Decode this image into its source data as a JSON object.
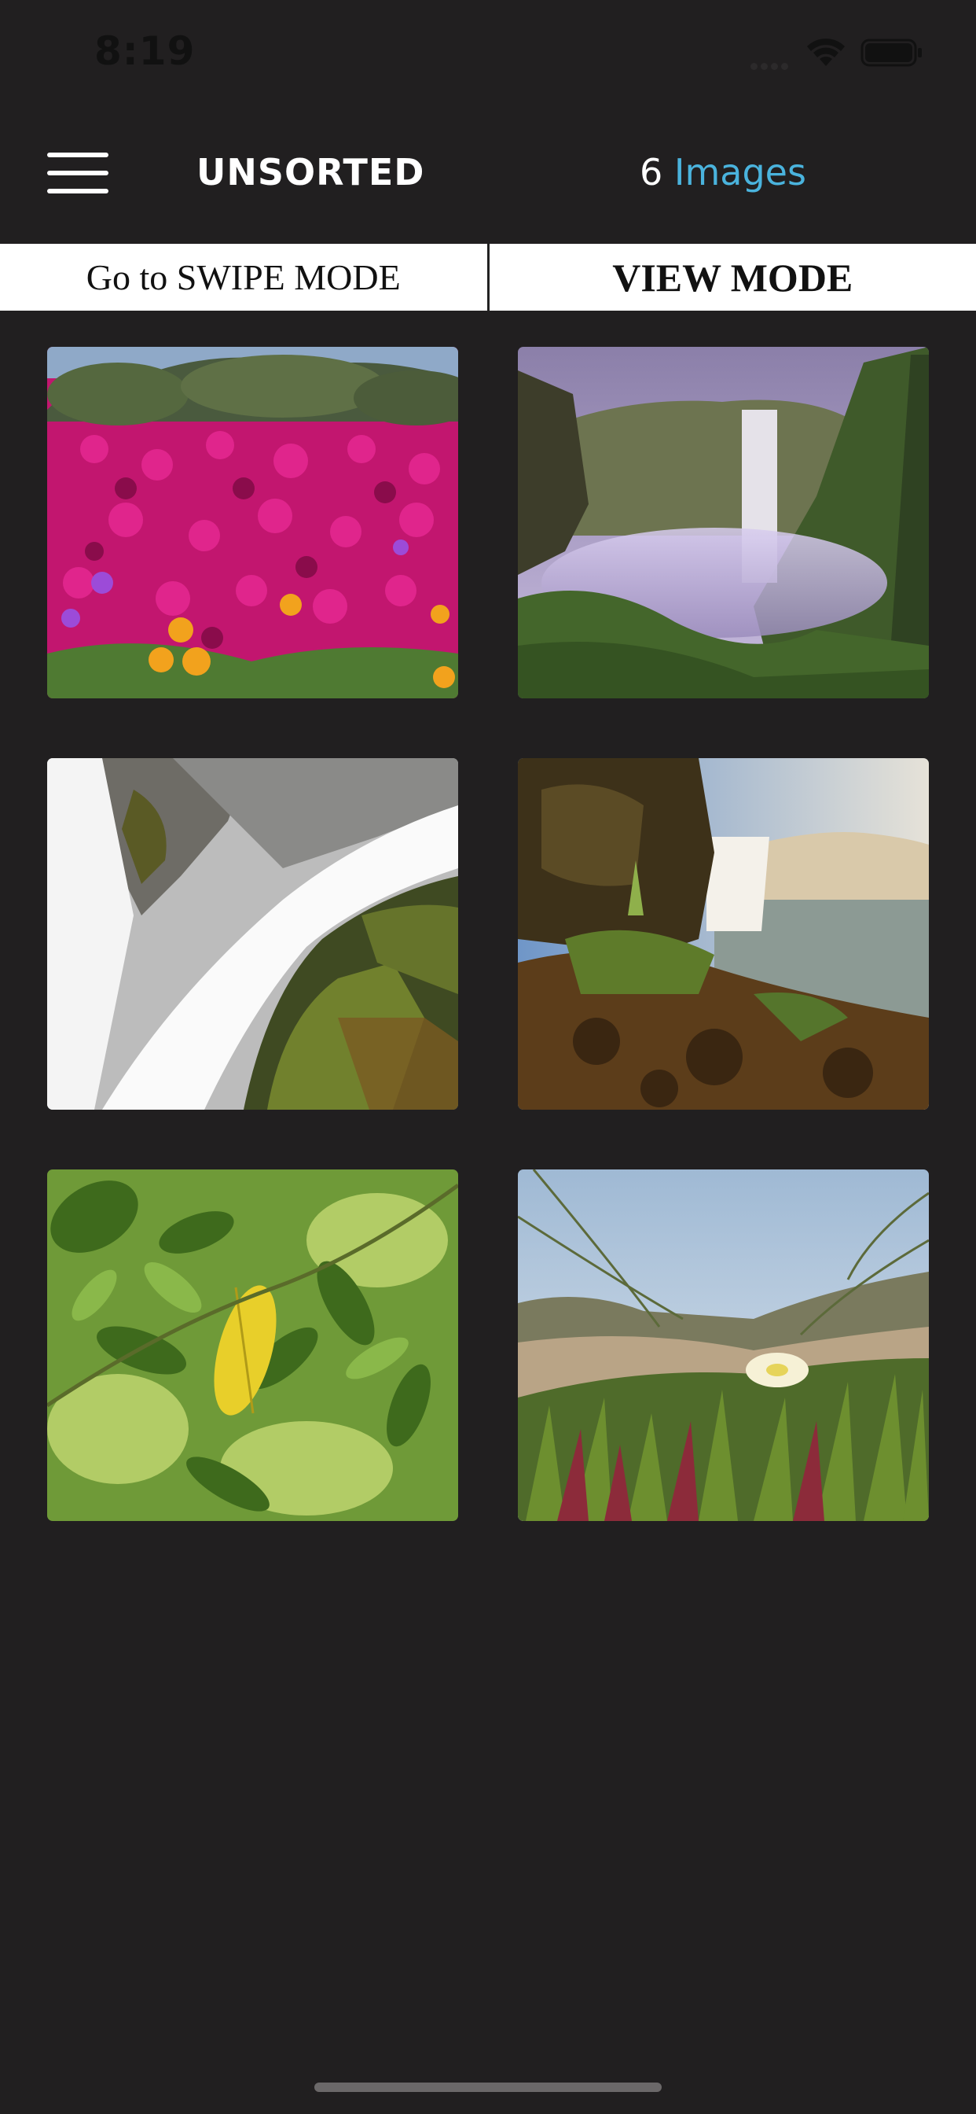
{
  "status_bar": {
    "time": "8:19"
  },
  "header": {
    "title": "UNSORTED",
    "count_number": "6",
    "count_label": "Images"
  },
  "modes": {
    "swipe_label": "Go to SWIPE MODE",
    "view_label": "VIEW MODE",
    "active": "view"
  },
  "images": [
    {
      "subject": "pink flower field"
    },
    {
      "subject": "misty waterfall in valley"
    },
    {
      "subject": "waterfall over mossy rocks"
    },
    {
      "subject": "waterfall with rocky foreground"
    },
    {
      "subject": "green leaves with yellow leaf"
    },
    {
      "subject": "ice plant with white flower"
    }
  ]
}
